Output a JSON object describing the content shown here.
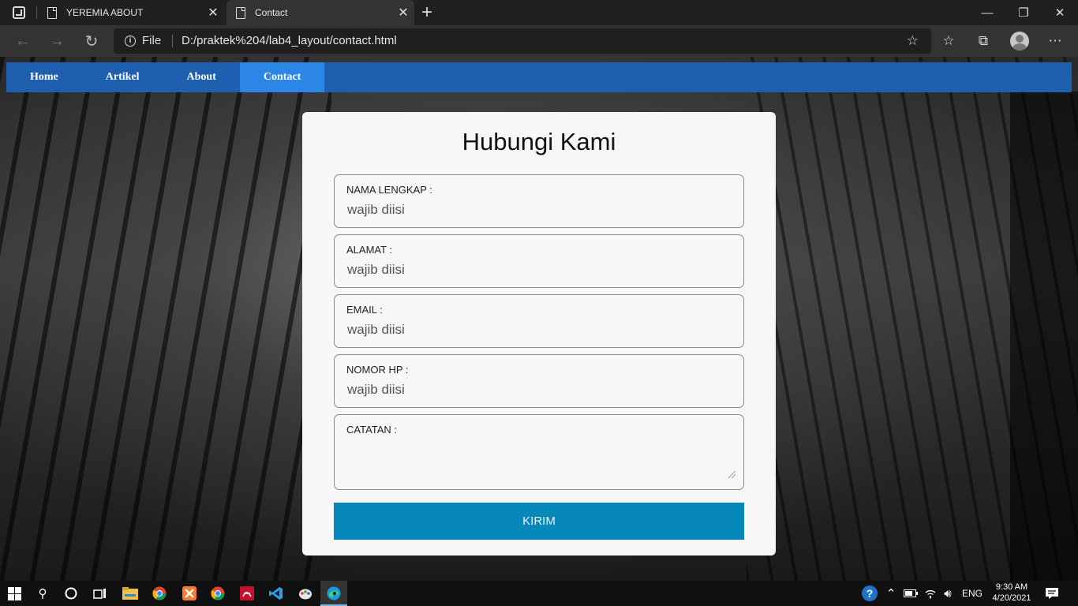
{
  "browser": {
    "tabs": [
      {
        "label": "YEREMIA ABOUT",
        "active": false
      },
      {
        "label": "Contact",
        "active": true
      }
    ],
    "file_label": "File",
    "url": "D:/praktek%204/lab4_layout/contact.html"
  },
  "nav": {
    "items": [
      "Home",
      "Artikel",
      "About",
      "Contact"
    ],
    "active": "Contact"
  },
  "form": {
    "title": "Hubungi Kami",
    "fields": [
      {
        "label": "NAMA LENGKAP :",
        "placeholder": "wajib diisi"
      },
      {
        "label": "ALAMAT :",
        "placeholder": "wajib diisi"
      },
      {
        "label": "EMAIL :",
        "placeholder": "wajib diisi"
      },
      {
        "label": "NOMOR HP :",
        "placeholder": "wajib diisi"
      }
    ],
    "notes_label": "CATATAN :",
    "submit_label": "KIRIM"
  },
  "taskbar": {
    "language": "ENG",
    "time": "9:30 AM",
    "date": "4/20/2021"
  },
  "colors": {
    "nav_bg": "#1f5fb0",
    "nav_active": "#2b86e6",
    "submit_bg": "#0788ba"
  }
}
